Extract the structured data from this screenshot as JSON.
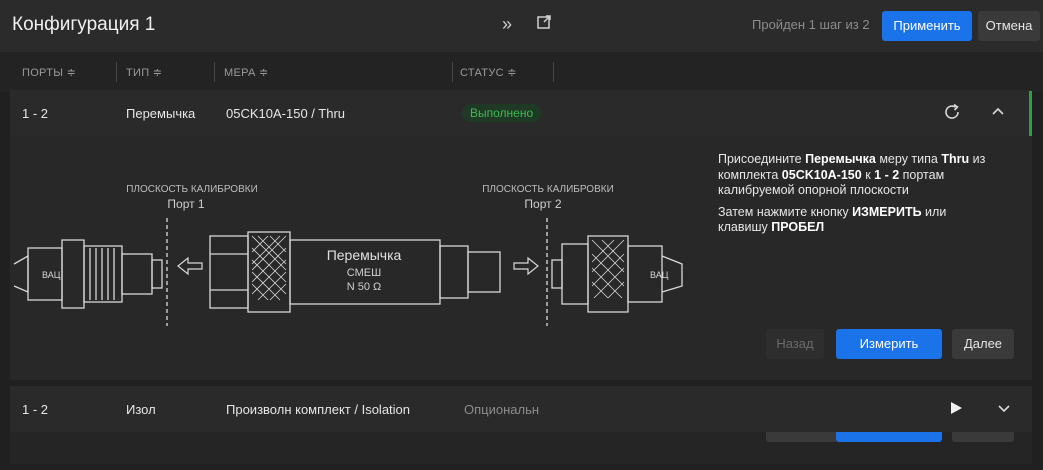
{
  "header": {
    "title": "Конфигурация 1",
    "step_text": "Пройден 1 шаг из 2",
    "apply_label": "Применить",
    "cancel_label": "Отмена",
    "icons": [
      "double-chevron-right-icon",
      "external-link-icon"
    ]
  },
  "columns": [
    "ПОРТЫ ≑",
    "ТИП ≑",
    "МЕРА ≑",
    "СТАТУС ≑"
  ],
  "rows": [
    {
      "ports": "1 - 2",
      "type": "Перемычка",
      "measure": "05CK10A-150 / Thru",
      "status": "Выполнено",
      "expanded": true
    },
    {
      "ports": "1 - 2",
      "type": "Изол",
      "measure": "Произволн комплект / Isolation",
      "status": "Опциональн",
      "expanded": false
    }
  ],
  "diagram": {
    "left_plane": "ПЛОСКОСТЬ КАЛИБРОВКИ",
    "left_port": "Порт 1",
    "right_plane": "ПЛОСКОСТЬ КАЛИБРОВКИ",
    "right_port": "Порт 2",
    "left_vna": "ВАЦ",
    "right_vna": "ВАЦ",
    "adapter_title": "Перемычка",
    "adapter_line2": "СМЕШ",
    "adapter_line3": "N 50 Ω"
  },
  "instructions": {
    "p1_a": "Присоедините ",
    "p1_b": "Перемычка",
    "p1_c": " меру типа ",
    "p1_d": "Thru",
    "p1_e": " из комплекта ",
    "p1_f": "05CK10A-150",
    "p1_g": " к ",
    "p1_h": "1 - 2",
    "p1_i": " портам калибруемой опорной плоскости",
    "p2_a": "Затем нажмите кнопку ",
    "p2_b": "ИЗМЕРИТЬ",
    "p2_c": " или клавишу ",
    "p2_d": "ПРОБЕЛ"
  },
  "panel_buttons": {
    "back_label": "Назад",
    "measure_label": "Измерить",
    "next_label": "Далее"
  },
  "colors": {
    "accent": "#1a73e8",
    "success": "#3fb950",
    "background": "#202020"
  }
}
